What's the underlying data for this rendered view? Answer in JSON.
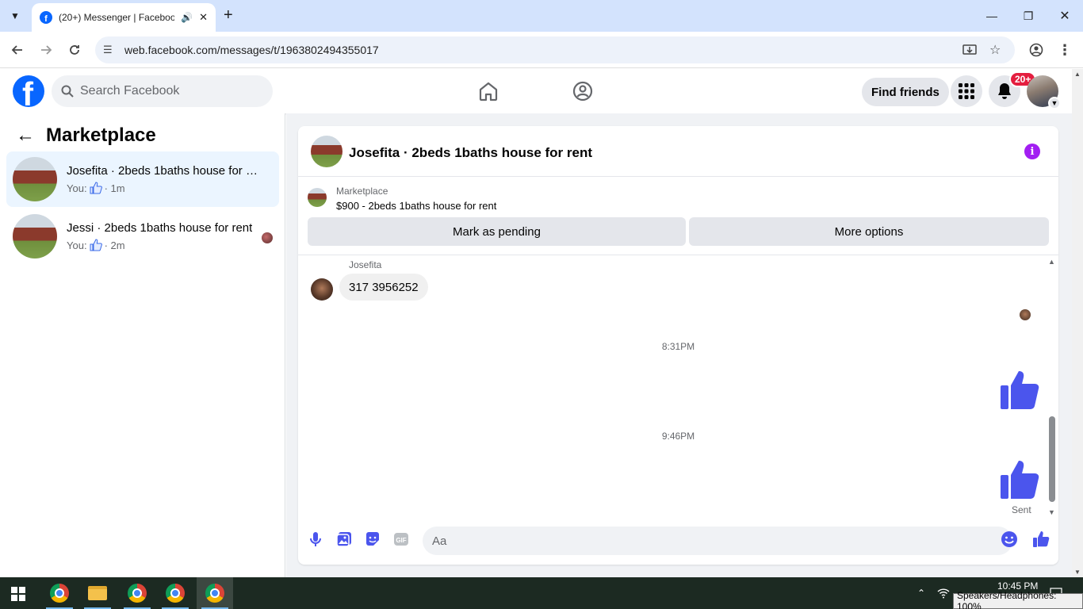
{
  "browser": {
    "tab_title": "(20+) Messenger | Facebook",
    "url": "web.facebook.com/messages/t/1963802494355017",
    "new_tab_symbol": "+",
    "favicon_letter": "f"
  },
  "fb": {
    "logo_letter": "f",
    "search_placeholder": "Search Facebook",
    "find_friends_label": "Find friends",
    "notifications_badge": "20+",
    "brand_color": "#0866ff"
  },
  "sidebar": {
    "title": "Marketplace",
    "conversations": [
      {
        "name": "Josefita · 2beds 1baths house for rent",
        "prefix": "You:",
        "time": "· 1m",
        "active": true
      },
      {
        "name": "Jessi · 2beds 1baths house for rent",
        "prefix": "You:",
        "time": "· 2m",
        "active": false
      }
    ]
  },
  "chat": {
    "title": "Josefita · 2beds 1baths house for rent",
    "marketplace_label": "Marketplace",
    "listing": "$900 - 2beds 1baths house for rent",
    "mark_pending_label": "Mark as pending",
    "more_options_label": "More options",
    "sender_name": "Josefita",
    "received_message": "317 3956252",
    "timestamps": [
      "8:31PM",
      "9:46PM"
    ],
    "sent_status": "Sent",
    "composer_placeholder": "Aa",
    "accent_color": "#4b55ed"
  },
  "taskbar": {
    "time": "10:45 PM",
    "tooltip": "Speakers/Headphones: 100%"
  }
}
